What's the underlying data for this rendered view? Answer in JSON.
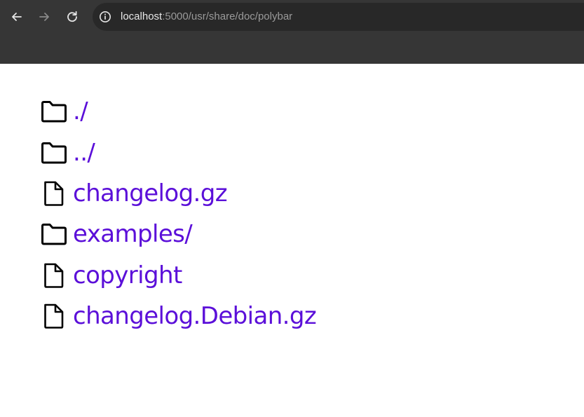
{
  "browser": {
    "url_host": "localhost",
    "url_rest": ":5000/usr/share/doc/polybar",
    "colors": {
      "chrome_bg": "#363636",
      "omnibox_bg": "#282828",
      "link": "#5b0fd9"
    }
  },
  "listing": {
    "entries": [
      {
        "label": "./",
        "icon": "folder-icon"
      },
      {
        "label": "../",
        "icon": "folder-icon"
      },
      {
        "label": "changelog.gz",
        "icon": "file-icon"
      },
      {
        "label": "examples/",
        "icon": "folder-icon"
      },
      {
        "label": "copyright",
        "icon": "file-icon"
      },
      {
        "label": "changelog.Debian.gz",
        "icon": "file-icon"
      }
    ]
  }
}
